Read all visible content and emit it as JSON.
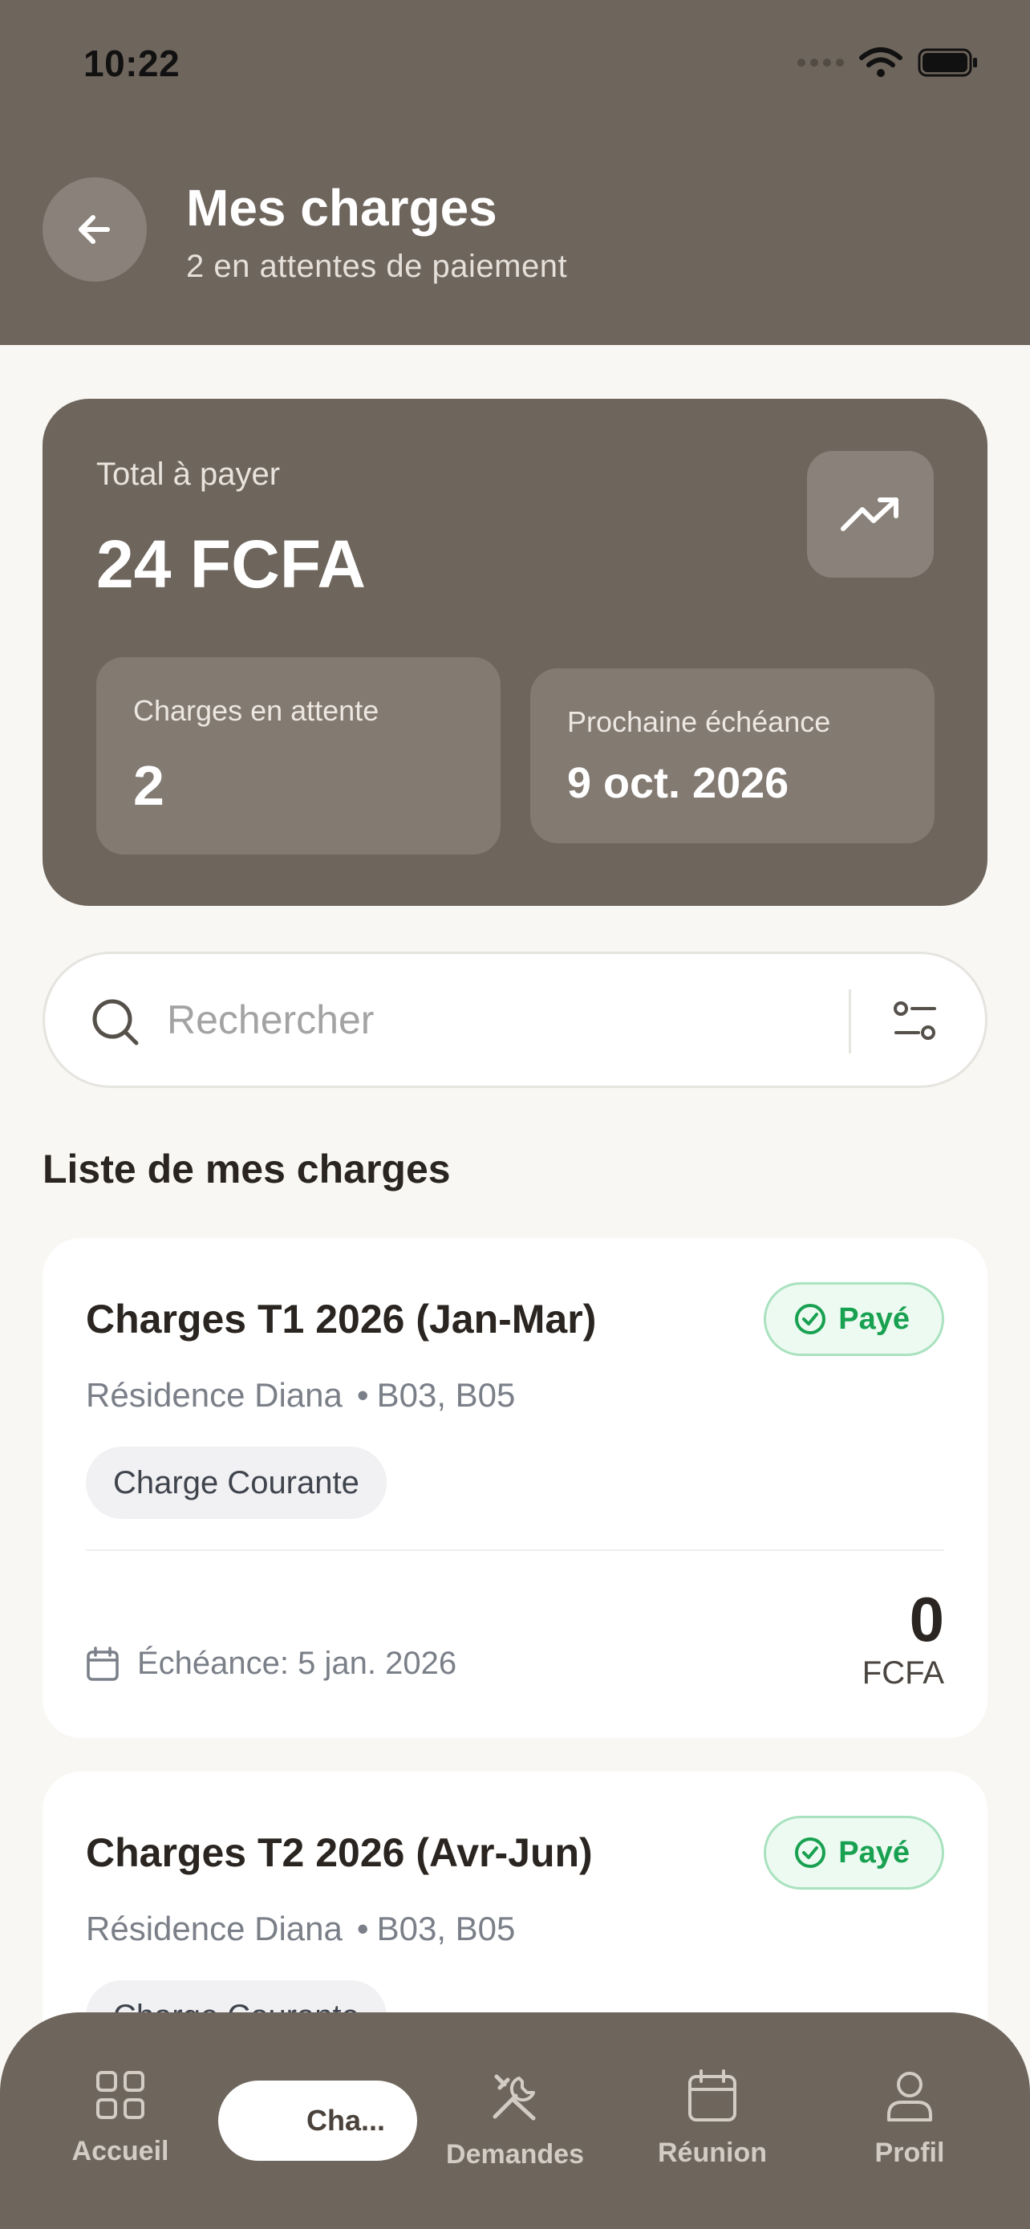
{
  "status_bar": {
    "time": "10:22"
  },
  "header": {
    "title": "Mes charges",
    "subtitle": "2 en attentes de paiement"
  },
  "summary": {
    "total_label": "Total à payer",
    "total_amount": "24 FCFA",
    "pending_label": "Charges en attente",
    "pending_value": "2",
    "next_due_label": "Prochaine échéance",
    "next_due_value": "9 oct. 2026"
  },
  "search": {
    "placeholder": "Rechercher"
  },
  "section_title": "Liste de mes charges",
  "charges": [
    {
      "title": "Charges T1 2026 (Jan-Mar)",
      "status": "Payé",
      "residence": "Résidence Diana",
      "units": "B03, B05",
      "tag": "Charge Courante",
      "due": "Échéance: 5 jan. 2026",
      "amount": "0",
      "currency": "FCFA"
    },
    {
      "title": "Charges T2 2026 (Avr-Jun)",
      "status": "Payé",
      "residence": "Résidence Diana",
      "units": "B03, B05",
      "tag": "Charge Courante"
    }
  ],
  "nav": {
    "home": "Accueil",
    "charges": "Cha...",
    "requests": "Demandes",
    "meeting": "Réunion",
    "profile": "Profil"
  },
  "colors": {
    "brand": "#6E655C",
    "background": "#F8F7F3",
    "paid_green": "#18A150"
  }
}
